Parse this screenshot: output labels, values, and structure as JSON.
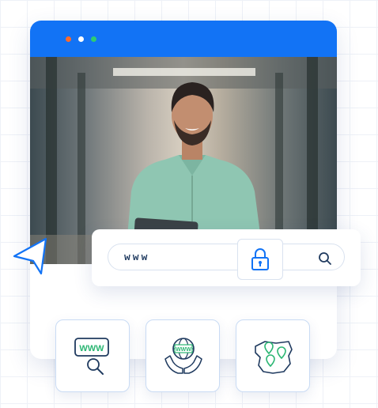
{
  "colors": {
    "accent": "#1273f5",
    "window_dots": [
      "#ff6a2b",
      "#ffffff",
      "#2ecc71"
    ],
    "icon_green": "#2bb673",
    "icon_navy": "#1f3a5f"
  },
  "browser_window": {
    "photo": "person-holding-tablet-photo"
  },
  "address_bar": {
    "text": "www",
    "lock_icon": "padlock-icon",
    "search_icon": "magnifier-icon"
  },
  "cursor_icon": "pointer-arrow-icon",
  "feature_tiles": [
    {
      "icon": "www-search-icon",
      "text": "WWW"
    },
    {
      "icon": "globe-hands-icon",
      "text": "WWW"
    },
    {
      "icon": "map-pins-icon"
    }
  ]
}
